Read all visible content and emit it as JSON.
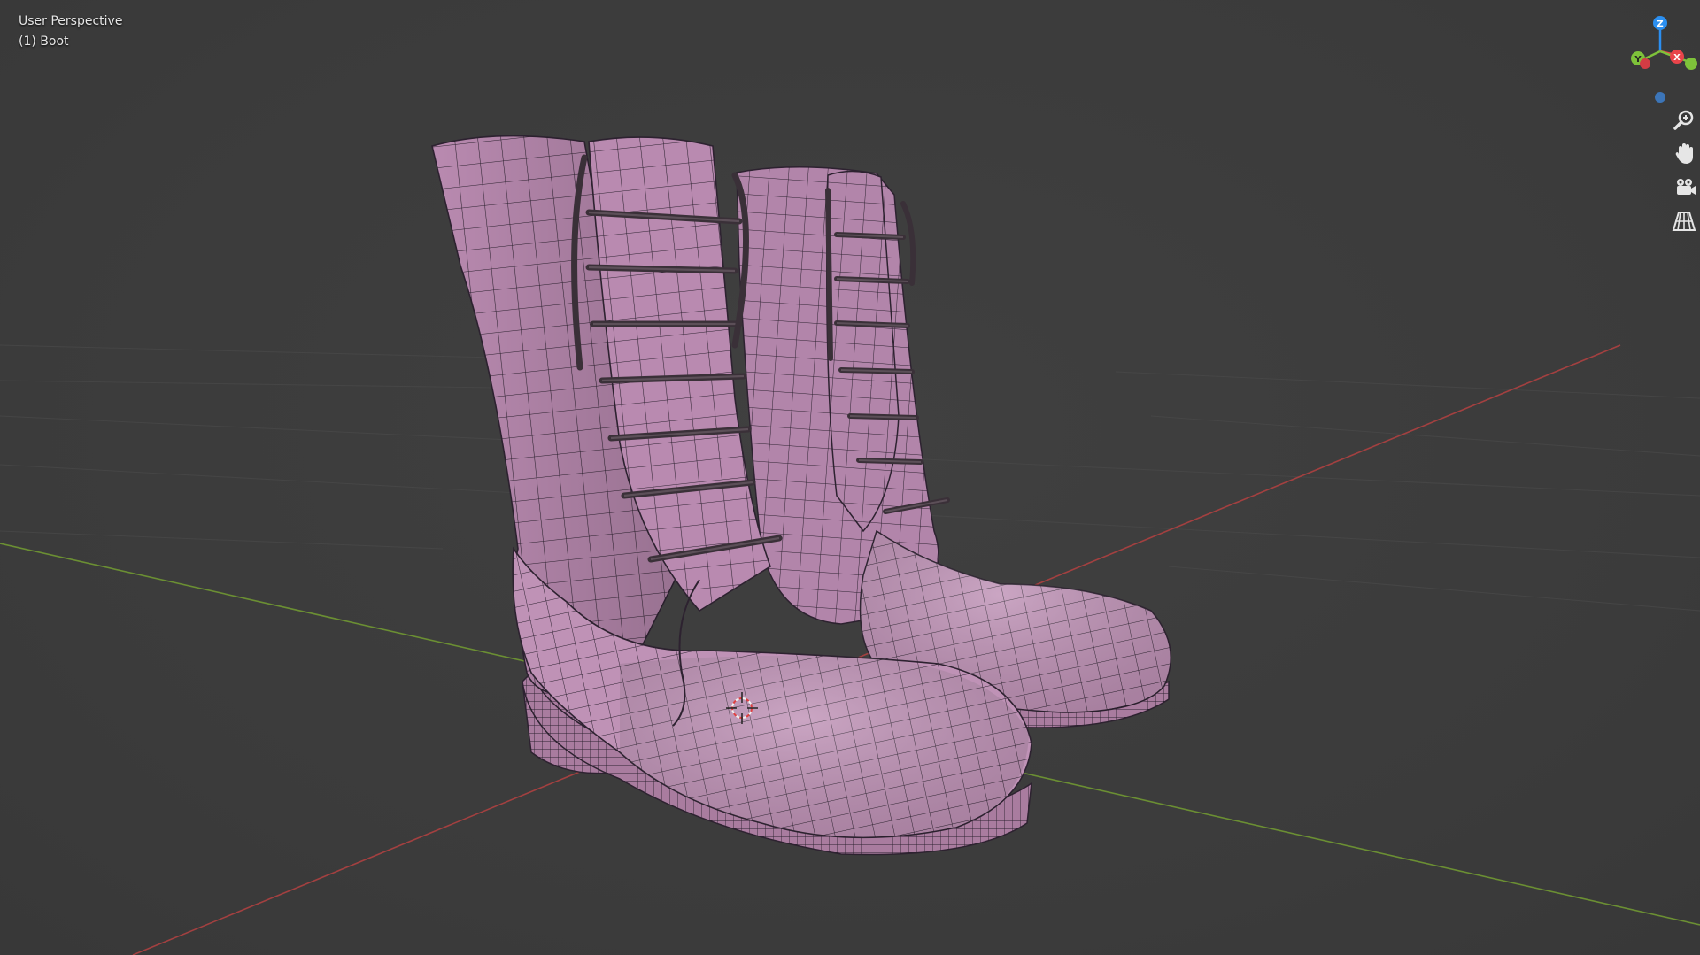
{
  "viewport": {
    "view_name": "User Perspective",
    "object_name": "(1) Boot"
  },
  "gizmo": {
    "axes": [
      {
        "label": "Z",
        "color": "#2b8ff0"
      },
      {
        "label": "Y",
        "color": "#7ec23a"
      },
      {
        "label": "X",
        "color": "#e8444a"
      }
    ]
  },
  "nav_buttons": [
    {
      "name": "zoom-icon"
    },
    {
      "name": "pan-hand-icon"
    },
    {
      "name": "camera-view-icon"
    },
    {
      "name": "ortho-grid-icon"
    }
  ],
  "colors": {
    "background": "#3d3d3d",
    "mesh_fill": "#b98ab0",
    "mesh_wire": "#2a1f28",
    "x_axis": "#a34040",
    "y_axis": "#6b8f33",
    "grid": "#464646"
  }
}
